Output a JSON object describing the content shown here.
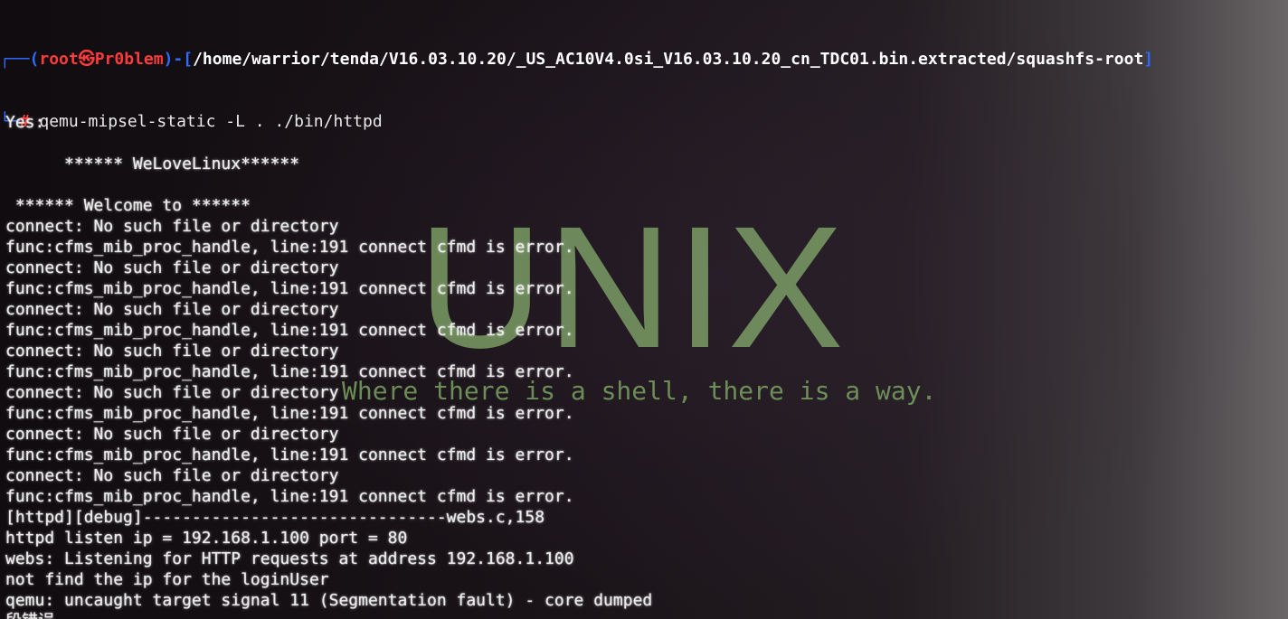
{
  "prompt": {
    "corner_top": "┌──(",
    "user": "root㉿Pr0blem",
    "mid": ")-[",
    "path": "/home/warrior/tenda/V16.03.10.20/_US_AC10V4.0si_V16.03.10.20_cn_TDC01.bin.extracted/squashfs-root",
    "end": "]",
    "corner_bottom": "└─",
    "hash": "#",
    "command": " qemu-mipsel-static -L . ./bin/httpd"
  },
  "wallpaper": {
    "logo_text": "UNIX",
    "slogan": "Where there is a shell, there is a way."
  },
  "output": {
    "lines": [
      "",
      "Yes:",
      "",
      "      ****** WeLoveLinux******",
      "",
      " ****** Welcome to ******",
      "connect: No such file or directory",
      "func:cfms_mib_proc_handle, line:191 connect cfmd is error.",
      "connect: No such file or directory",
      "func:cfms_mib_proc_handle, line:191 connect cfmd is error.",
      "connect: No such file or directory",
      "func:cfms_mib_proc_handle, line:191 connect cfmd is error.",
      "connect: No such file or directory",
      "func:cfms_mib_proc_handle, line:191 connect cfmd is error.",
      "connect: No such file or directory",
      "func:cfms_mib_proc_handle, line:191 connect cfmd is error.",
      "connect: No such file or directory",
      "func:cfms_mib_proc_handle, line:191 connect cfmd is error.",
      "connect: No such file or directory",
      "func:cfms_mib_proc_handle, line:191 connect cfmd is error.",
      "[httpd][debug]-------------------------------webs.c,158",
      "httpd listen ip = 192.168.1.100 port = 80",
      "webs: Listening for HTTP requests at address 192.168.1.100",
      "not find the ip for the loginUser",
      "qemu: uncaught target signal 11 (Segmentation fault) - core dumped",
      "段错误"
    ]
  },
  "colors": {
    "prompt_bracket": "#2f6bff",
    "prompt_user": "#ff3b3b",
    "prompt_path": "#ffffff",
    "output_text": "#ececec",
    "wallpaper_logo": "#82a86a"
  }
}
